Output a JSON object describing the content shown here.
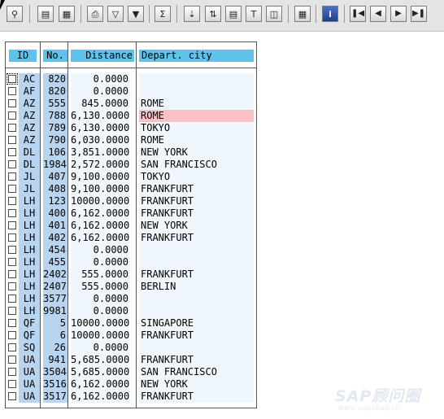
{
  "toolbar": {
    "icons": [
      "zoom-icon",
      "select-layout-icon",
      "display-layout-icon",
      "print-icon",
      "filter-icon",
      "set-filter-icon",
      "sum-icon",
      "export-icon",
      "sort-icon",
      "save-icon",
      "abc-icon",
      "find-icon",
      "grid-icon",
      "info-icon",
      "first-page-icon",
      "prev-page-icon",
      "next-page-icon",
      "last-page-icon"
    ]
  },
  "table": {
    "headers": {
      "id": "ID",
      "no": "No.",
      "distance": "Distance",
      "city": "Depart. city"
    },
    "rows": [
      {
        "id": "AC",
        "no": "820",
        "distance": "0.0000",
        "city": ""
      },
      {
        "id": "AF",
        "no": "820",
        "distance": "0.0000",
        "city": ""
      },
      {
        "id": "AZ",
        "no": "555",
        "distance": "845.0000",
        "city": "ROME"
      },
      {
        "id": "AZ",
        "no": "788",
        "distance": "6,130.0000",
        "city": "ROME"
      },
      {
        "id": "AZ",
        "no": "789",
        "distance": "6,130.0000",
        "city": "TOKYO"
      },
      {
        "id": "AZ",
        "no": "790",
        "distance": "6,030.0000",
        "city": "ROME"
      },
      {
        "id": "DL",
        "no": "106",
        "distance": "3,851.0000",
        "city": "NEW YORK"
      },
      {
        "id": "DL",
        "no": "1984",
        "distance": "2,572.0000",
        "city": "SAN FRANCISCO"
      },
      {
        "id": "JL",
        "no": "407",
        "distance": "9,100.0000",
        "city": "TOKYO"
      },
      {
        "id": "JL",
        "no": "408",
        "distance": "9,100.0000",
        "city": "FRANKFURT"
      },
      {
        "id": "LH",
        "no": "123",
        "distance": "10000.0000",
        "city": "FRANKFURT"
      },
      {
        "id": "LH",
        "no": "400",
        "distance": "6,162.0000",
        "city": "FRANKFURT"
      },
      {
        "id": "LH",
        "no": "401",
        "distance": "6,162.0000",
        "city": "NEW YORK"
      },
      {
        "id": "LH",
        "no": "402",
        "distance": "6,162.0000",
        "city": "FRANKFURT"
      },
      {
        "id": "LH",
        "no": "454",
        "distance": "0.0000",
        "city": ""
      },
      {
        "id": "LH",
        "no": "455",
        "distance": "0.0000",
        "city": ""
      },
      {
        "id": "LH",
        "no": "2402",
        "distance": "555.0000",
        "city": "FRANKFURT"
      },
      {
        "id": "LH",
        "no": "2407",
        "distance": "555.0000",
        "city": "BERLIN"
      },
      {
        "id": "LH",
        "no": "3577",
        "distance": "0.0000",
        "city": ""
      },
      {
        "id": "LH",
        "no": "9981",
        "distance": "0.0000",
        "city": ""
      },
      {
        "id": "QF",
        "no": "5",
        "distance": "10000.0000",
        "city": "SINGAPORE"
      },
      {
        "id": "QF",
        "no": "6",
        "distance": "10000.0000",
        "city": "FRANKFURT"
      },
      {
        "id": "SQ",
        "no": "26",
        "distance": "0.0000",
        "city": ""
      },
      {
        "id": "UA",
        "no": "941",
        "distance": "5,685.0000",
        "city": "FRANKFURT"
      },
      {
        "id": "UA",
        "no": "3504",
        "distance": "5,685.0000",
        "city": "SAN FRANCISCO"
      },
      {
        "id": "UA",
        "no": "3516",
        "distance": "6,162.0000",
        "city": "NEW YORK"
      },
      {
        "id": "UA",
        "no": "3517",
        "distance": "6,162.0000",
        "city": "FRANKFURT"
      }
    ],
    "highlighted_row_index": 3,
    "focused_row_index": 0,
    "colors": {
      "header": "#5fc2ea",
      "key_cell": "#b8d4ee",
      "data_cell": "#f0f7fc",
      "highlight": "#f9c1c4"
    }
  },
  "watermark": {
    "title": "SAP顾问圈",
    "url": "www.sapabap.cn"
  }
}
